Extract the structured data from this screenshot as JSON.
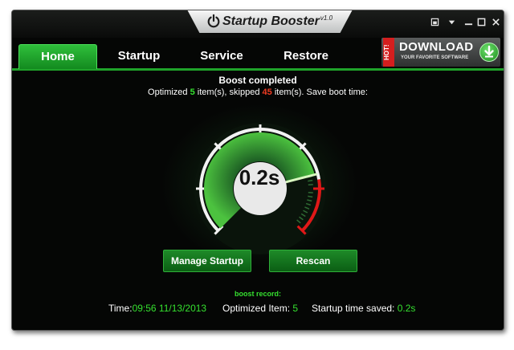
{
  "window": {
    "title": "Startup Booster",
    "version": "v1.0",
    "controls": [
      "pin-icon",
      "dropdown-icon",
      "minimize-icon",
      "close-icon"
    ]
  },
  "nav": {
    "tabs": [
      {
        "label": "Home",
        "active": true
      },
      {
        "label": "Startup",
        "active": false
      },
      {
        "label": "Service",
        "active": false
      },
      {
        "label": "Restore",
        "active": false
      }
    ]
  },
  "ad": {
    "badge": "HOT!",
    "title": "DOWNLOAD",
    "subtitle": "YOUR FAVORITE SOFTWARE",
    "icon": "download-arrow-icon"
  },
  "status": {
    "title": "Boost completed",
    "optimized_prefix": "Optimized",
    "optimized_count": "5",
    "skipped_prefix": "item(s), skipped",
    "skipped_count": "45",
    "suffix": "item(s). Save boot time:"
  },
  "gauge": {
    "value_label": "0.2s",
    "level": 0.78,
    "red_zone_start": 0.8
  },
  "buttons": {
    "manage": "Manage Startup",
    "rescan": "Rescan"
  },
  "record": {
    "title": "boost record:",
    "time_label": "Time:",
    "time_value": "09:56 11/13/2013",
    "items_label": "Optimized Item:",
    "items_value": "5",
    "saved_label": "Startup time saved:",
    "saved_value": "0.2s"
  },
  "colors": {
    "accent_green": "#35e02f",
    "warning_red": "#ef3b22",
    "background": "#050605"
  }
}
